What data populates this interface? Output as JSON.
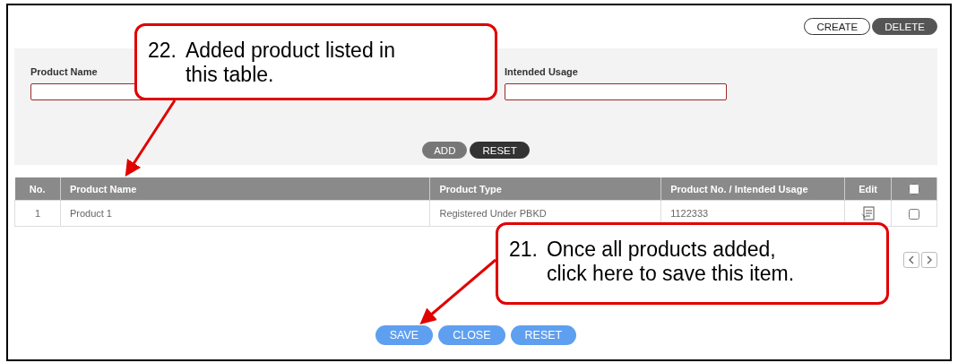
{
  "toolbar": {
    "buttons": [
      {
        "label": "CREATE",
        "kind": "outline"
      },
      {
        "label": "DELETE",
        "kind": "dark"
      }
    ]
  },
  "form": {
    "fields": [
      {
        "label": "Product Name"
      },
      {
        "label": "Intended Usage"
      }
    ],
    "buttons": [
      {
        "label": "ADD",
        "kind": "gray"
      },
      {
        "label": "RESET",
        "kind": "dark"
      }
    ]
  },
  "table": {
    "columns": [
      "No.",
      "Product Name",
      "Product Type",
      "Product No. / Intended Usage",
      "Edit"
    ],
    "select_all_checked": false,
    "rows": [
      {
        "cells": [
          "1",
          "Product 1",
          "Registered Under PBKD",
          "1122333"
        ],
        "checked": false
      }
    ]
  },
  "footer_buttons": [
    "SAVE",
    "CLOSE",
    "RESET"
  ],
  "callouts": [
    {
      "number": "22.",
      "text": "Added product listed in this table."
    },
    {
      "number": "21.",
      "text": "Once all products added, click here to save this item."
    }
  ]
}
